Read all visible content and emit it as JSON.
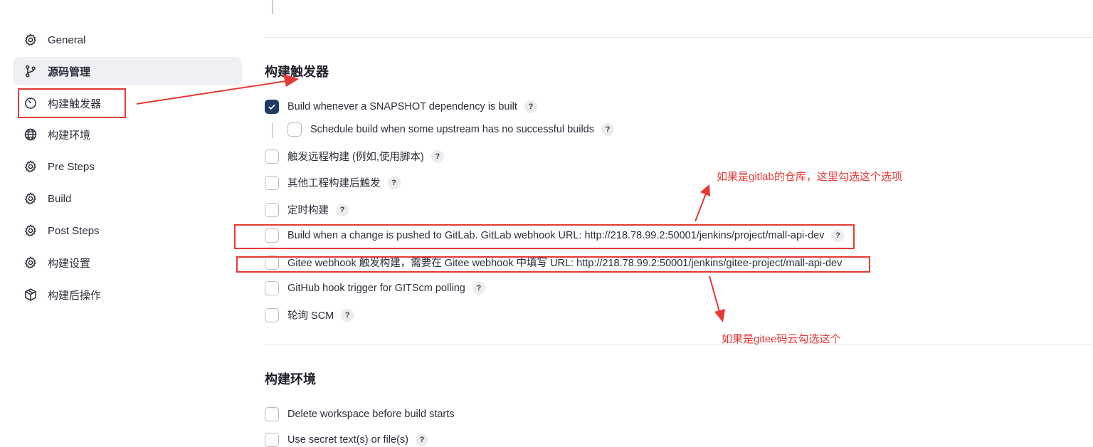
{
  "sidebar": {
    "items": [
      {
        "label": "General",
        "icon": "gear-icon"
      },
      {
        "label": "源码管理",
        "icon": "branch-icon"
      },
      {
        "label": "构建触发器",
        "icon": "timer-icon"
      },
      {
        "label": "构建环境",
        "icon": "globe-icon"
      },
      {
        "label": "Pre Steps",
        "icon": "gear-icon"
      },
      {
        "label": "Build",
        "icon": "gear-icon"
      },
      {
        "label": "Post Steps",
        "icon": "gear-icon"
      },
      {
        "label": "构建设置",
        "icon": "gear-icon"
      },
      {
        "label": "构建后操作",
        "icon": "package-icon"
      }
    ]
  },
  "triggers": {
    "title": "构建触发器",
    "options": [
      {
        "label": "Build whenever a SNAPSHOT dependency is built",
        "checked": true,
        "help": "?"
      },
      {
        "label": "Schedule build when some upstream has no successful builds",
        "checked": false,
        "help": "?"
      },
      {
        "label": "触发远程构建 (例如,使用脚本)",
        "checked": false,
        "help": "?"
      },
      {
        "label": "其他工程构建后触发",
        "checked": false,
        "help": "?"
      },
      {
        "label": "定时构建",
        "checked": false,
        "help": "?"
      },
      {
        "label": "Build when a change is pushed to GitLab. GitLab webhook URL: http://218.78.99.2:50001/jenkins/project/mall-api-dev",
        "checked": false,
        "help": "?"
      },
      {
        "label": "Gitee webhook 触发构建，需要在 Gitee webhook 中填写 URL: http://218.78.99.2:50001/jenkins/gitee-project/mall-api-dev",
        "checked": false
      },
      {
        "label": "GitHub hook trigger for GITScm polling",
        "checked": false,
        "help": "?"
      },
      {
        "label": "轮询 SCM",
        "checked": false,
        "help": "?"
      }
    ]
  },
  "environment": {
    "title": "构建环境",
    "options": [
      {
        "label": "Delete workspace before build starts",
        "checked": false
      },
      {
        "label": "Use secret text(s) or file(s)",
        "checked": false,
        "help": "?"
      }
    ]
  },
  "annotations": {
    "gitlab_note": "如果是gitlab的仓库，这里勾选这个选项",
    "gitee_note": "如果是gitee码云勾选这个",
    "color": "#e53935"
  },
  "theme": {
    "checkbox_checked": "#1b3d63",
    "active_bg": "#eef0f4"
  }
}
